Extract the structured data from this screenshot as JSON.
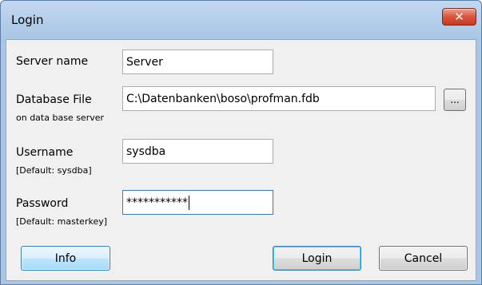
{
  "window": {
    "title": "Login",
    "close_label": "✕"
  },
  "form": {
    "server": {
      "label": "Server name",
      "value": "Server"
    },
    "database": {
      "label": "Database File",
      "hint": "on data base server",
      "value": "C:\\Datenbanken\\boso\\profman.fdb",
      "browse_label": "..."
    },
    "username": {
      "label": "Username",
      "hint": "[Default: sysdba]",
      "value": "sysdba"
    },
    "password": {
      "label": "Password",
      "hint": "[Default: masterkey]",
      "value": "***********"
    }
  },
  "buttons": {
    "info": "Info",
    "login": "Login",
    "cancel": "Cancel"
  }
}
